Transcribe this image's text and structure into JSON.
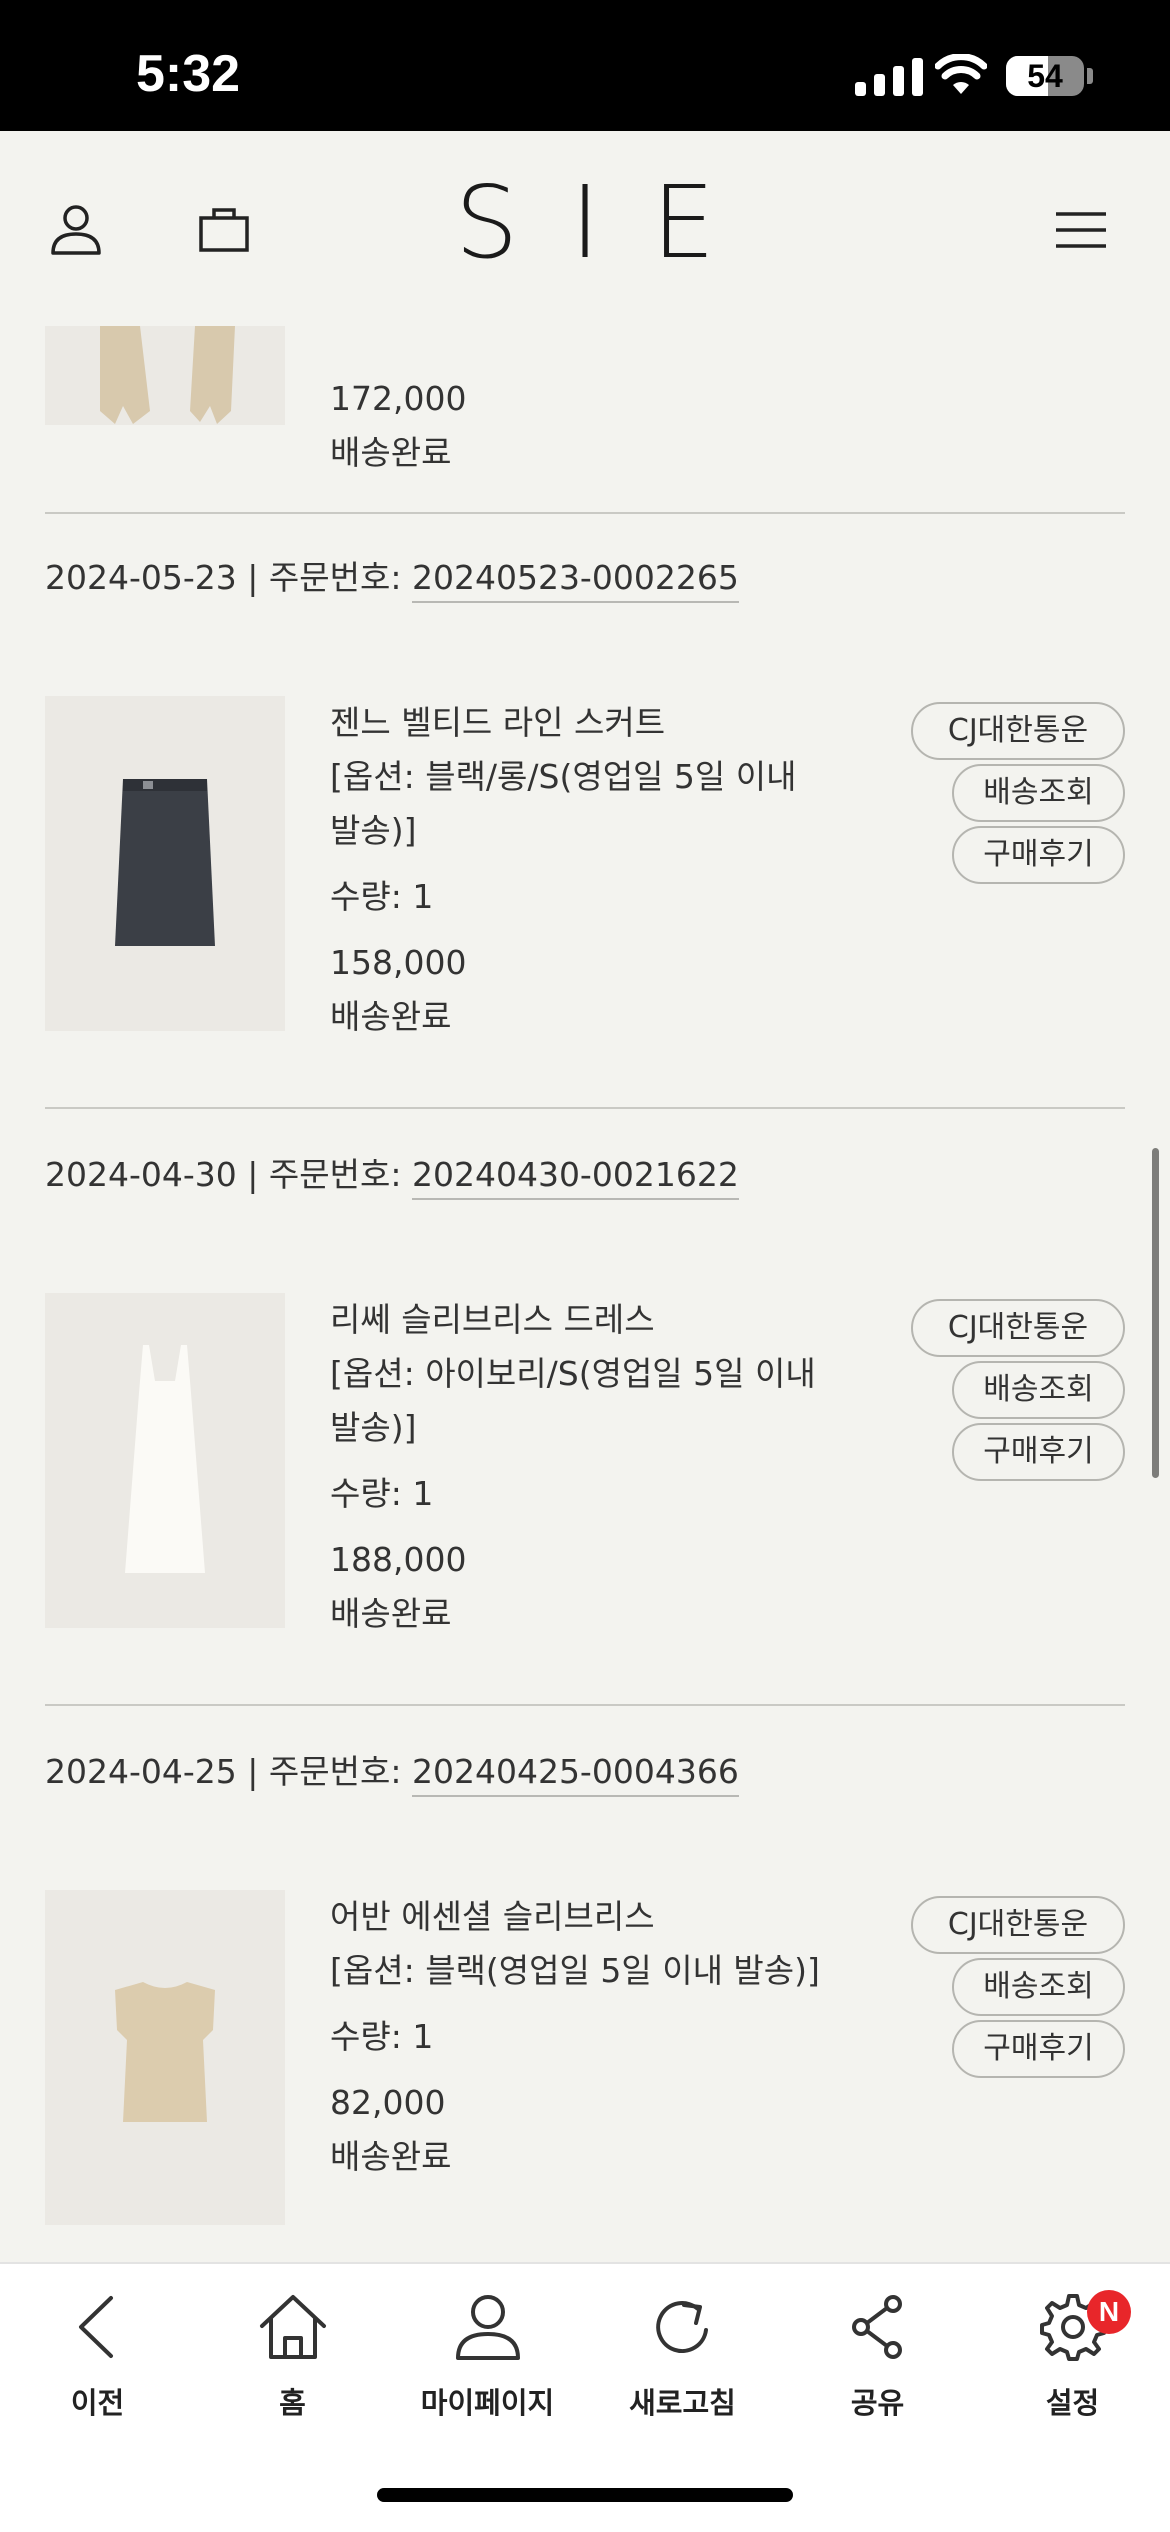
{
  "status_bar": {
    "time": "5:32",
    "battery": "54",
    "battery_level": 0.54
  },
  "header": {
    "logo": "SIE"
  },
  "partial_order": {
    "price": "172,000",
    "status": "배송완료"
  },
  "orders": [
    {
      "date": "2024-05-23",
      "separator": "|",
      "order_label": "주문번호:",
      "order_number": "20240523-0002265",
      "product_name": "젠느 벨티드 라인 스커트",
      "option_line1": "[옵션: 블랙/롱/S(영업일 5일 이내",
      "option_line2": "발송)]",
      "quantity": "수량: 1",
      "price": "158,000",
      "status": "배송완료",
      "carrier": "CJ대한통운",
      "track_label": "배송조회",
      "review_label": "구매후기"
    },
    {
      "date": "2024-04-30",
      "separator": "|",
      "order_label": "주문번호:",
      "order_number": "20240430-0021622",
      "product_name": "리쎄 슬리브리스 드레스",
      "option_line1": "[옵션: 아이보리/S(영업일 5일 이내",
      "option_line2": "발송)]",
      "quantity": "수량: 1",
      "price": "188,000",
      "status": "배송완료",
      "carrier": "CJ대한통운",
      "track_label": "배송조회",
      "review_label": "구매후기"
    },
    {
      "date": "2024-04-25",
      "separator": "|",
      "order_label": "주문번호:",
      "order_number": "20240425-0004366",
      "product_name": "어반 에센셜 슬리브리스",
      "option_line1": "[옵션: 블랙(영업일 5일 이내 발송)]",
      "option_line2": "",
      "quantity": "수량: 1",
      "price": "82,000",
      "status": "배송완료",
      "carrier": "CJ대한통운",
      "track_label": "배송조회",
      "review_label": "구매후기"
    }
  ],
  "tabbar": {
    "back": "이전",
    "home": "홈",
    "mypage": "마이페이지",
    "refresh": "새로고침",
    "share": "공유",
    "settings": "설정",
    "settings_badge": "N"
  },
  "colors": {
    "background": "#f3f3ef",
    "badge": "#e8262a",
    "text": "#2b2b2b"
  }
}
